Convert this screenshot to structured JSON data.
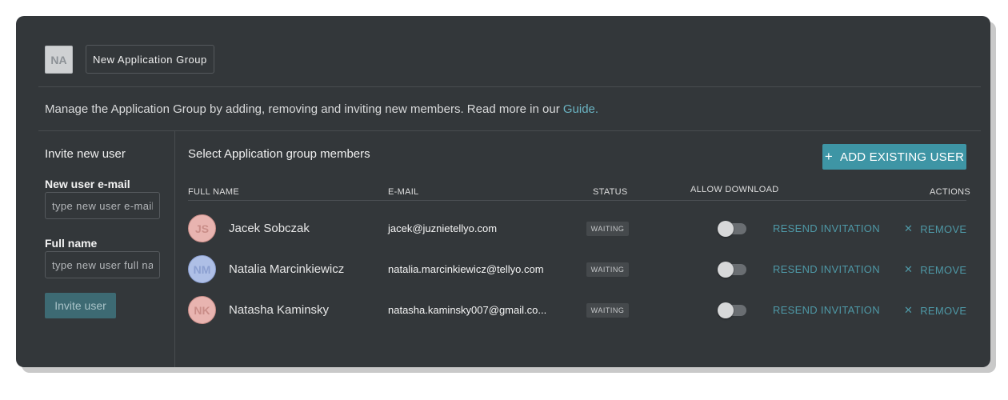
{
  "group": {
    "avatar_initials": "NA",
    "name": "New Application Group"
  },
  "description": {
    "text": "Manage the Application Group by adding, removing and inviting new members. Read more in our ",
    "link": "Guide."
  },
  "sidebar": {
    "title": "Invite new user",
    "email_label": "New user e-mail",
    "email_placeholder": "type new user e-mail",
    "name_label": "Full name",
    "name_placeholder": "type new user full name",
    "invite_button": "Invite user"
  },
  "main": {
    "title": "Select Application group members",
    "add_button": "ADD EXISTING USER",
    "add_icon": "plus-icon"
  },
  "table": {
    "headers": {
      "full_name": "FULL NAME",
      "email": "E-MAIL",
      "status": "STATUS",
      "allow_download": "ALLOW DOWNLOAD",
      "actions": "ACTIONS"
    },
    "resend_label": "RESEND INVITATION",
    "remove_label": "REMOVE",
    "remove_icon": "close-icon",
    "rows": [
      {
        "initials": "JS",
        "name": "Jacek Sobczak",
        "email": "jacek@juznietellyo.com",
        "status": "WAITING",
        "allow_download": false,
        "avatar_bg": "#e8b4b0",
        "avatar_fg": "#c98d88"
      },
      {
        "initials": "NM",
        "name": "Natalia Marcinkiewicz",
        "email": "natalia.marcinkiewicz@tellyo.com",
        "status": "WAITING",
        "allow_download": false,
        "avatar_bg": "#aebfe6",
        "avatar_fg": "#8b9fd0"
      },
      {
        "initials": "NK",
        "name": "Natasha Kaminsky",
        "email": "natasha.kaminsky007@gmail.co...",
        "status": "WAITING",
        "allow_download": false,
        "avatar_bg": "#e8b4b0",
        "avatar_fg": "#c98d88"
      }
    ]
  },
  "colors": {
    "panel": "#33373a",
    "accent": "#3e95a5",
    "link": "#6ab3c2"
  }
}
